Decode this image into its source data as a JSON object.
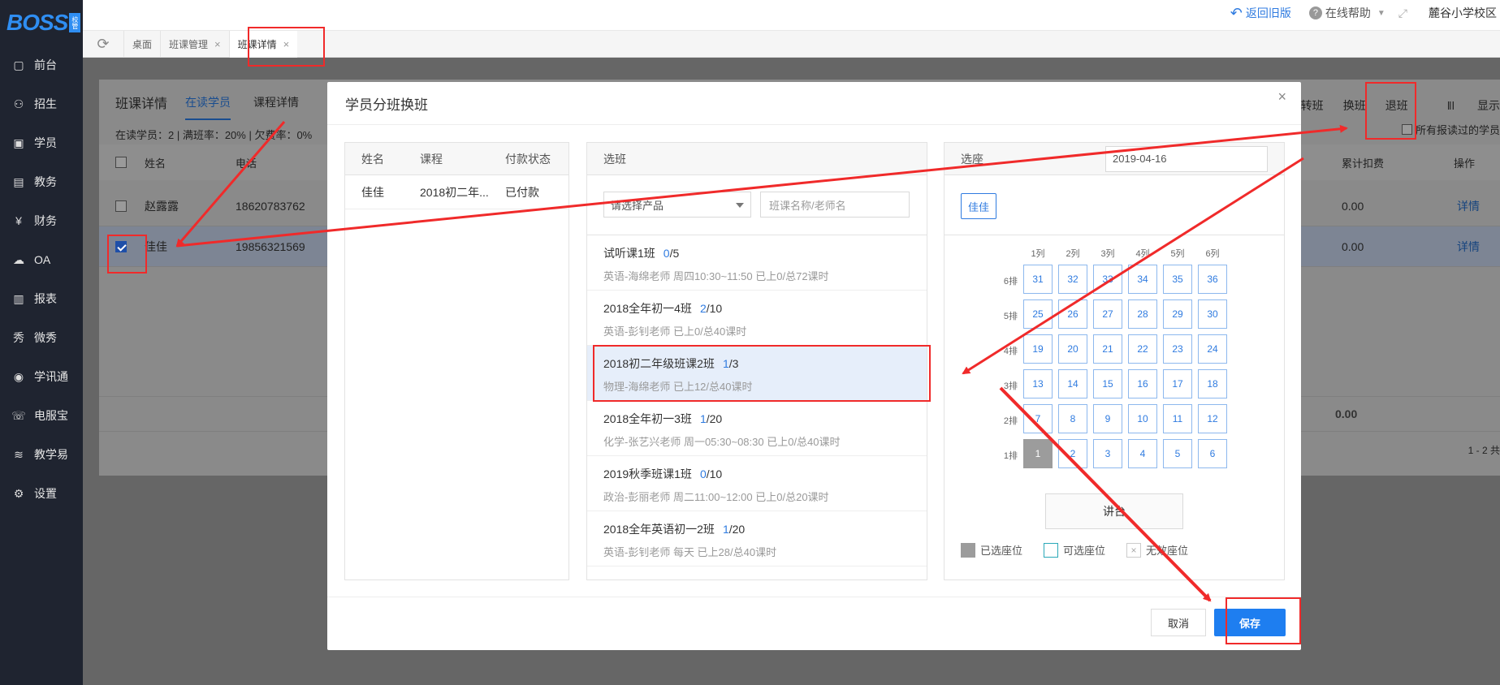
{
  "sidebar": {
    "logo": "BOSS",
    "logo_badge": "校管",
    "items": [
      {
        "label": "前台",
        "icon": "calendar-icon"
      },
      {
        "label": "招生",
        "icon": "user-plus-icon"
      },
      {
        "label": "学员",
        "icon": "id-card-icon"
      },
      {
        "label": "教务",
        "icon": "book-icon"
      },
      {
        "label": "财务",
        "icon": "yen-icon"
      },
      {
        "label": "OA",
        "icon": "cloud-icon"
      },
      {
        "label": "报表",
        "icon": "bar-chart-icon"
      },
      {
        "label": "微秀",
        "icon": "micro-show-icon"
      },
      {
        "label": "学讯通",
        "icon": "location-icon"
      },
      {
        "label": "电服宝",
        "icon": "phone-icon"
      },
      {
        "label": "教学易",
        "icon": "teach-icon"
      },
      {
        "label": "设置",
        "icon": "gear-icon"
      }
    ]
  },
  "topbar": {
    "old_version": "返回旧版",
    "help": "在线帮助",
    "campus": "麓谷小学校区"
  },
  "tabs": [
    {
      "label": "桌面",
      "closable": false
    },
    {
      "label": "班课管理",
      "closable": true
    },
    {
      "label": "班课详情",
      "closable": true,
      "active": true
    }
  ],
  "page": {
    "title": "班课详情",
    "subtabs": [
      "在读学员",
      "课程详情"
    ],
    "stats": "在读学员：2 | 满班率：20% | 欠费率：0%",
    "actions": [
      "补差转班",
      "换班",
      "退班",
      "显示"
    ],
    "all_students_checkbox": "所有报读过的学员",
    "columns": {
      "name": "姓名",
      "phone": "电话",
      "deduct": "累计扣费",
      "op": "操作"
    },
    "rows": [
      {
        "name": "赵露露",
        "phone": "18620783762",
        "deduct": "0.00",
        "op": "详情",
        "checked": false
      },
      {
        "name": "佳佳",
        "phone": "19856321569",
        "deduct": "0.00",
        "op": "详情",
        "checked": true
      }
    ],
    "total_deduct": "0.00",
    "pagination": "1 - 2  共"
  },
  "modal": {
    "title": "学员分班换班",
    "close": "×",
    "left": {
      "headers": [
        "姓名",
        "课程",
        "付款状态"
      ],
      "rows": [
        {
          "name": "佳佳",
          "course": "2018初二年...",
          "status": "已付款"
        }
      ]
    },
    "middle": {
      "header": "选班",
      "product_placeholder": "请选择产品",
      "search_placeholder": "班课名称/老师名",
      "classes": [
        {
          "name": "试听课1班",
          "count": "0",
          "total": "/5",
          "desc": "英语-海绵老师    周四10:30~11:50    已上0/总72课时"
        },
        {
          "name": "2018全年初一4班",
          "count": "2",
          "total": "/10",
          "desc": "英语-彭钊老师      已上0/总40课时"
        },
        {
          "name": "2018初二年级班课2班",
          "count": "1",
          "total": "/3",
          "desc": "物理-海绵老师      已上12/总40课时",
          "selected": true
        },
        {
          "name": "2018全年初一3班",
          "count": "1",
          "total": "/20",
          "desc": "化学-张艺兴老师    周一05:30~08:30    已上0/总40课时"
        },
        {
          "name": "2019秋季班课1班",
          "count": "0",
          "total": "/10",
          "desc": "政治-彭丽老师    周二11:00~12:00    已上0/总20课时"
        },
        {
          "name": "2018全年英语初一2班",
          "count": "1",
          "total": "/20",
          "desc": "英语-彭钊老师    每天    已上28/总40课时"
        }
      ]
    },
    "right": {
      "header": "选座",
      "date": "2019-04-16",
      "student_tag": "佳佳",
      "col_labels": [
        "1列",
        "2列",
        "3列",
        "4列",
        "5列",
        "6列"
      ],
      "row_labels": [
        "6排",
        "5排",
        "4排",
        "3排",
        "2排",
        "1排"
      ],
      "seats": [
        [
          "31",
          "32",
          "33",
          "34",
          "35",
          "36"
        ],
        [
          "25",
          "26",
          "27",
          "28",
          "29",
          "30"
        ],
        [
          "19",
          "20",
          "21",
          "22",
          "23",
          "24"
        ],
        [
          "13",
          "14",
          "15",
          "16",
          "17",
          "18"
        ],
        [
          "7",
          "8",
          "9",
          "10",
          "11",
          "12"
        ],
        [
          "1",
          "2",
          "3",
          "4",
          "5",
          "6"
        ]
      ],
      "taken_seat": "1",
      "podium": "讲台",
      "legend": {
        "selected": "已选座位",
        "available": "可选座位",
        "invalid": "无效座位",
        "invalid_mark": "×"
      }
    },
    "cancel": "取消",
    "save": "保存"
  },
  "colors": {
    "accent": "#1e7ef0",
    "highlight": "#f02a2a",
    "sidebar": "#1f2430"
  }
}
